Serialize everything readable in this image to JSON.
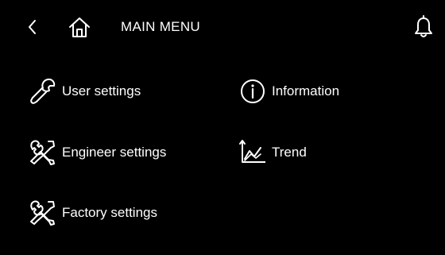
{
  "header": {
    "title": "MAIN MENU",
    "back_icon": "chevron-left-icon",
    "home_icon": "home-icon",
    "notification_icon": "bell-icon"
  },
  "menu": {
    "user_settings": {
      "label": "User settings",
      "icon": "wrench-icon"
    },
    "engineer_settings": {
      "label": "Engineer settings",
      "icon": "tools-icon"
    },
    "factory_settings": {
      "label": "Factory settings",
      "icon": "tools-icon"
    },
    "information": {
      "label": "Information",
      "icon": "info-icon"
    },
    "trend": {
      "label": "Trend",
      "icon": "trend-chart-icon"
    }
  },
  "colors": {
    "background": "#000000",
    "foreground": "#ffffff"
  }
}
